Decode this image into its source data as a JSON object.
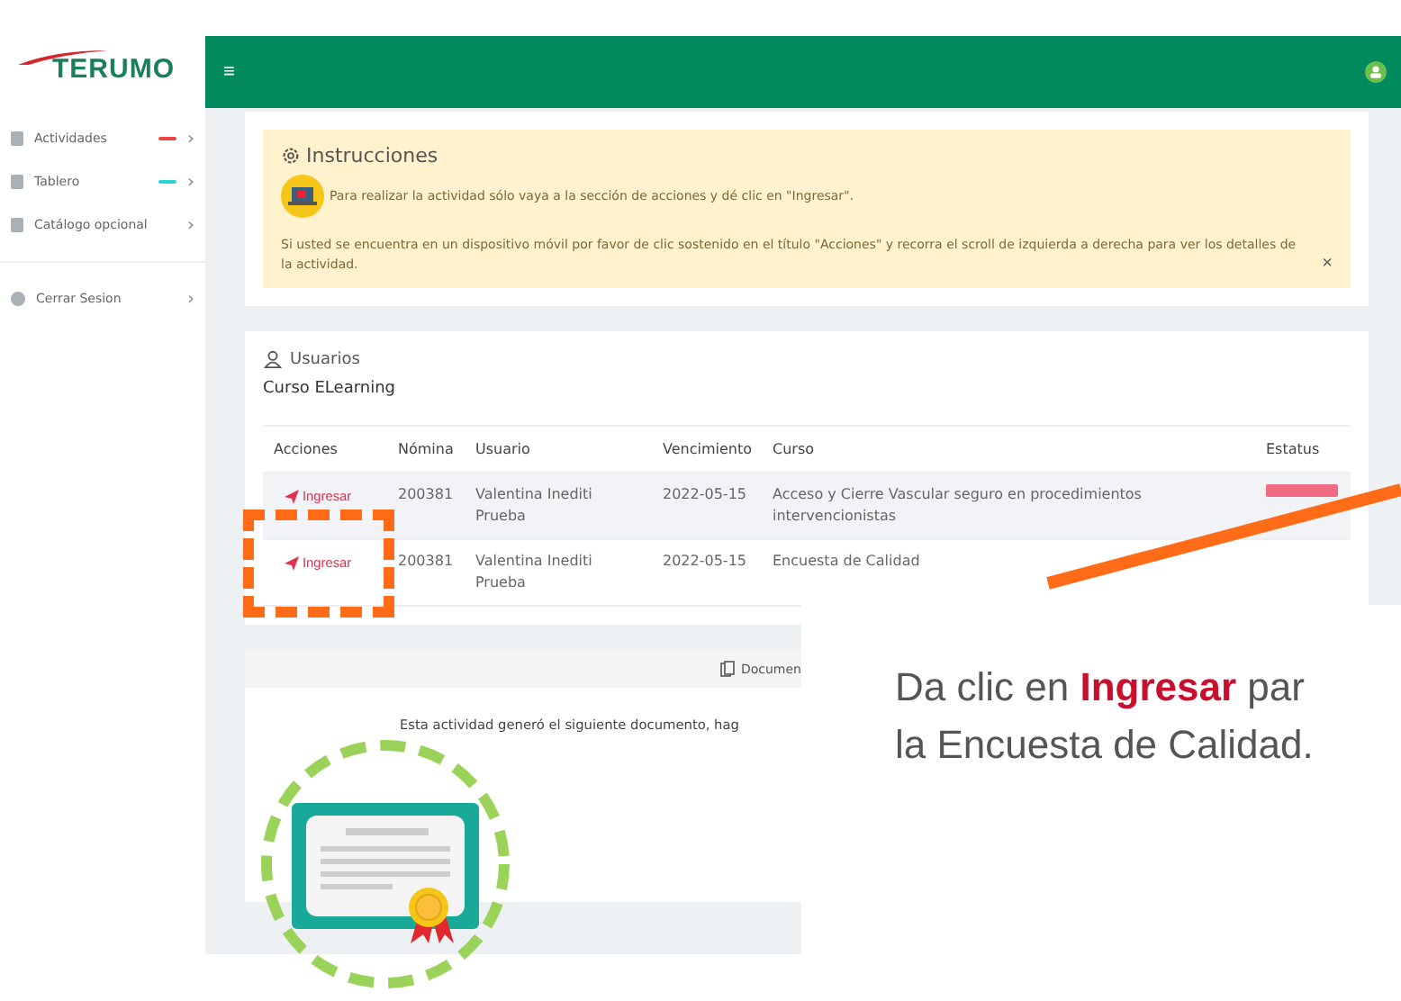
{
  "sidebar": {
    "logo": "TERUMO",
    "items": [
      {
        "label": "Actividades",
        "color": "#ef4444",
        "chevron": "›"
      },
      {
        "label": "Tablero",
        "color": "#2dd4d4",
        "chevron": "›"
      },
      {
        "label": "Catálogo opcional",
        "chevron": "›"
      },
      {
        "label": "Cerrar Sesion",
        "chevron": "›",
        "kind": "logout"
      }
    ]
  },
  "topbar": {
    "menu": "≡"
  },
  "instructions": {
    "title": "Instrucciones",
    "line": "Para realizar la actividad sólo vaya a la sección de acciones y dé clic en \"Ingresar\".",
    "mobile_note": "Si usted se encuentra en un dispositivo móvil por favor de clic sostenido en el título \"Acciones\" y recorra el scroll de izquierda a derecha para ver los detalles de la actividad.",
    "close": "×"
  },
  "users": {
    "title": "Usuarios",
    "course": "Curso ELearning",
    "table": {
      "columns": [
        "Acciones",
        "Nómina",
        "Usuario",
        "Vencimiento",
        "Curso",
        "Estatus"
      ],
      "rows": [
        {
          "action": "Ingresar",
          "nomina": "200381",
          "usuario": "Valentina Inediti Prueba",
          "vencimiento": "2022-05-15",
          "curso": "Acceso y Cierre Vascular seguro en procedimientos intervencionistas",
          "status_badge": true
        },
        {
          "action": "Ingresar",
          "nomina": "200381",
          "usuario": "Valentina Inediti Prueba",
          "vencimiento": "2022-05-15",
          "curso": "Encuesta de Calidad",
          "status_badge": false
        }
      ]
    }
  },
  "document": {
    "header": "Documen",
    "text": "Esta actividad generó el siguiente documento, hag"
  },
  "callout": {
    "lines": [
      "Da clic en **Ingresar** par",
      "la Encuesta de Calidad."
    ]
  }
}
